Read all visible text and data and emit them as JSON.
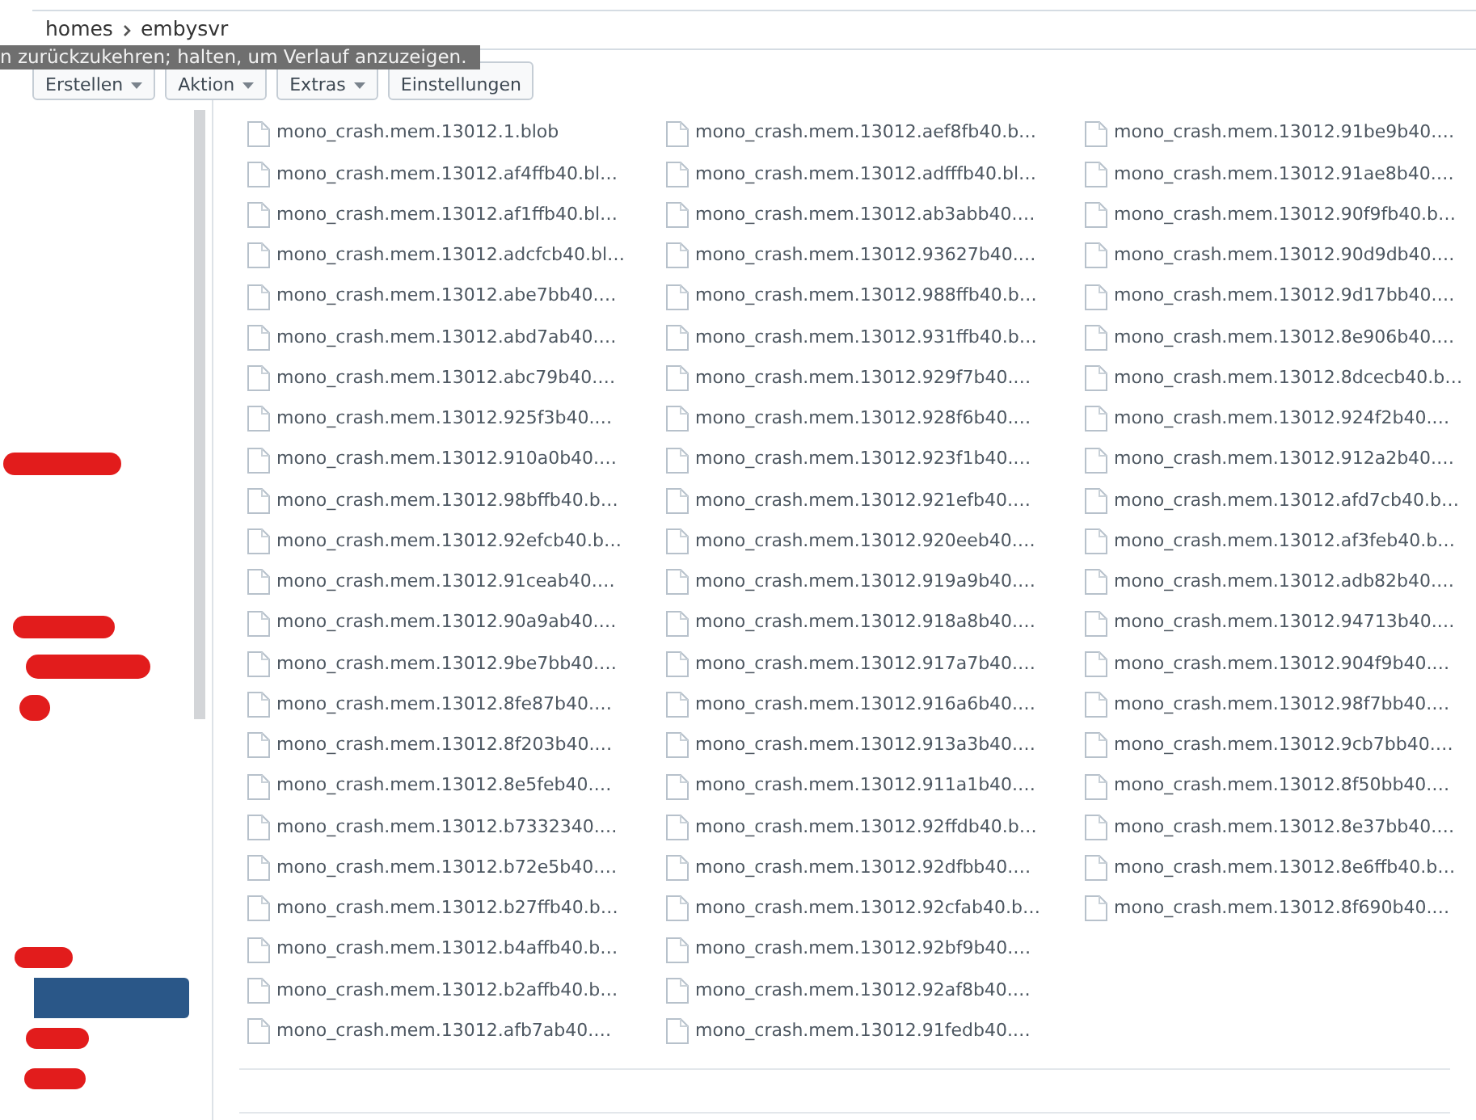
{
  "breadcrumb": [
    {
      "label": "homes"
    },
    {
      "label": "embysvr"
    }
  ],
  "tooltip": {
    "text": "n zurückzukehren; halten, um Verlauf anzuzeigen."
  },
  "toolbar": {
    "buttons": [
      {
        "label": "Erstellen",
        "has_menu": true
      },
      {
        "label": "Aktion",
        "has_menu": true
      },
      {
        "label": "Extras",
        "has_menu": true
      },
      {
        "label": "Einstellungen",
        "has_menu": false
      }
    ]
  },
  "sidebar": {
    "items": [
      {
        "kind": "redacted",
        "selected": false
      },
      {
        "kind": "redacted",
        "selected": false
      },
      {
        "kind": "redacted",
        "selected": false
      },
      {
        "kind": "redacted",
        "selected": false
      },
      {
        "kind": "redacted",
        "selected": false
      },
      {
        "kind": "folder",
        "selected": true
      },
      {
        "kind": "redacted",
        "selected": false
      },
      {
        "kind": "redacted",
        "selected": false
      }
    ]
  },
  "files": [
    "mono_crash.mem.13012.1.blob",
    "mono_crash.mem.13012.af4ffb40.bl…",
    "mono_crash.mem.13012.af1ffb40.bl…",
    "mono_crash.mem.13012.adcfcb40.bl…",
    "mono_crash.mem.13012.abe7bb40.…",
    "mono_crash.mem.13012.abd7ab40.…",
    "mono_crash.mem.13012.abc79b40.…",
    "mono_crash.mem.13012.925f3b40.…",
    "mono_crash.mem.13012.910a0b40.…",
    "mono_crash.mem.13012.98bffb40.b…",
    "mono_crash.mem.13012.92efcb40.b…",
    "mono_crash.mem.13012.91ceab40.…",
    "mono_crash.mem.13012.90a9ab40.…",
    "mono_crash.mem.13012.9be7bb40.…",
    "mono_crash.mem.13012.8fe87b40.…",
    "mono_crash.mem.13012.8f203b40.…",
    "mono_crash.mem.13012.8e5feb40.…",
    "mono_crash.mem.13012.b7332340.…",
    "mono_crash.mem.13012.b72e5b40.…",
    "mono_crash.mem.13012.b27ffb40.b…",
    "mono_crash.mem.13012.b4affb40.b…",
    "mono_crash.mem.13012.b2affb40.b…",
    "mono_crash.mem.13012.afb7ab40.…",
    "mono_crash.mem.13012.aef8fb40.b…",
    "mono_crash.mem.13012.adfffb40.bl…",
    "mono_crash.mem.13012.ab3abb40.…",
    "mono_crash.mem.13012.93627b40.…",
    "mono_crash.mem.13012.988ffb40.b…",
    "mono_crash.mem.13012.931ffb40.b…",
    "mono_crash.mem.13012.929f7b40.…",
    "mono_crash.mem.13012.928f6b40.…",
    "mono_crash.mem.13012.923f1b40.…",
    "mono_crash.mem.13012.921efb40.…",
    "mono_crash.mem.13012.920eeb40.…",
    "mono_crash.mem.13012.919a9b40.…",
    "mono_crash.mem.13012.918a8b40.…",
    "mono_crash.mem.13012.917a7b40.…",
    "mono_crash.mem.13012.916a6b40.…",
    "mono_crash.mem.13012.913a3b40.…",
    "mono_crash.mem.13012.911a1b40.…",
    "mono_crash.mem.13012.92ffdb40.b…",
    "mono_crash.mem.13012.92dfbb40.…",
    "mono_crash.mem.13012.92cfab40.b…",
    "mono_crash.mem.13012.92bf9b40.…",
    "mono_crash.mem.13012.92af8b40.…",
    "mono_crash.mem.13012.91fedb40.…",
    "mono_crash.mem.13012.91be9b40.…",
    "mono_crash.mem.13012.91ae8b40.…",
    "mono_crash.mem.13012.90f9fb40.b…",
    "mono_crash.mem.13012.90d9db40.…",
    "mono_crash.mem.13012.9d17bb40.…",
    "mono_crash.mem.13012.8e906b40.…",
    "mono_crash.mem.13012.8dcecb40.b…",
    "mono_crash.mem.13012.924f2b40.…",
    "mono_crash.mem.13012.912a2b40.…",
    "mono_crash.mem.13012.afd7cb40.b…",
    "mono_crash.mem.13012.af3feb40.b…",
    "mono_crash.mem.13012.adb82b40.…",
    "mono_crash.mem.13012.94713b40.…",
    "mono_crash.mem.13012.904f9b40.…",
    "mono_crash.mem.13012.98f7bb40.…",
    "mono_crash.mem.13012.9cb7bb40.…",
    "mono_crash.mem.13012.8f50bb40.…",
    "mono_crash.mem.13012.8e37bb40.…",
    "mono_crash.mem.13012.8e6ffb40.b…",
    "mono_crash.mem.13012.8f690b40.…"
  ]
}
